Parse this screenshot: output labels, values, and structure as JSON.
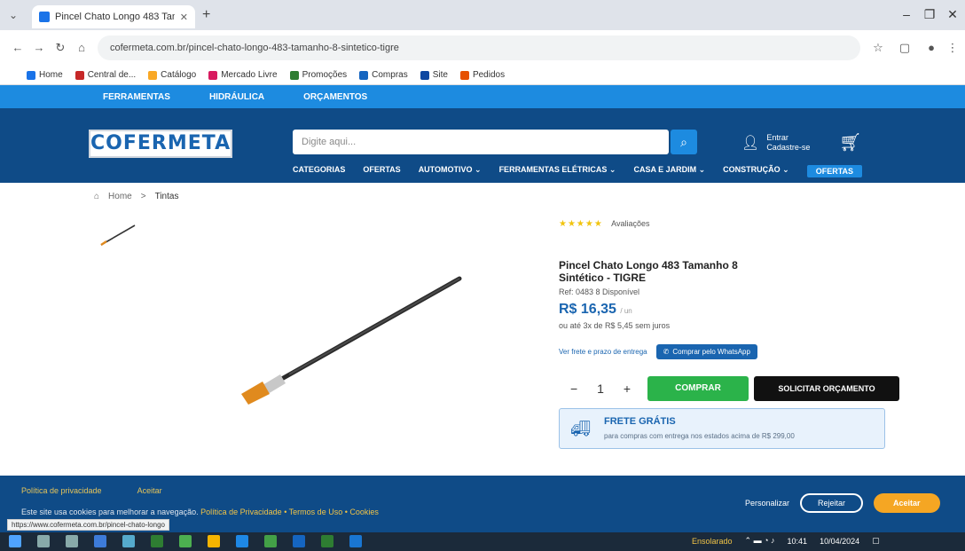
{
  "browser": {
    "tab_title": "Pincel Chato Longo 483 Tama",
    "url": "cofermeta.com.br/pincel-chato-longo-483-tamanho-8-sintetico-tigre",
    "bookmarks": [
      "Home",
      "Central de...",
      "Catálogo",
      "Mercado Livre",
      "Promoções",
      "Compras",
      "Site",
      "Pedidos"
    ]
  },
  "top_strip": [
    "FERRAMENTAS",
    "HIDRÁULICA",
    "ORÇAMENTOS"
  ],
  "header": {
    "logo": "COFERMETA",
    "search_placeholder": "Digite aqui...",
    "account_line1": "Entrar",
    "account_line2": "Cadastre-se",
    "menu": [
      "CATEGORIAS",
      "OFERTAS",
      "AUTOMOTIVO ⌄",
      "FERRAMENTAS ELÉTRICAS ⌄",
      "CASA E JARDIM ⌄",
      "CONSTRUÇÃO ⌄",
      "OFERTAS"
    ]
  },
  "breadcrumb": {
    "home": "Home",
    "sep": ">",
    "current": "Tintas"
  },
  "product": {
    "rating_stars": "★★★★★",
    "reviews": "Avaliações",
    "name": "Pincel Chato Longo 483 Tamanho 8 Sintético - TIGRE",
    "sku": "Ref: 0483 8 Disponível",
    "price": "R$ 16,35",
    "price_unit": "/ un",
    "installments": "ou até 3x de R$ 5,45 sem juros",
    "shipping_link": "Ver frete e prazo de entrega",
    "whatsapp_label": "Comprar pelo WhatsApp",
    "quantity": "1",
    "buy_label": "COMPRAR",
    "quote_label": "SOLICITAR ORÇAMENTO",
    "frete_title": "FRETE GRÁTIS",
    "frete_sub": "para compras com entrega nos estados acima de R$ 299,00"
  },
  "cookie": {
    "title": "Política de privacidade",
    "link": "Aceitar",
    "text": "Este site usa cookies para melhorar a navegação.",
    "links": "Política de Privacidade  •  Termos de Uso  •  Cookies",
    "manage": "Personalizar",
    "reject": "Rejeitar",
    "accept": "Aceitar"
  },
  "status_url": "https://www.cofermeta.com.br/pincel-chato-longo",
  "taskbar": {
    "weather": "Ensolarado",
    "time": "10:41",
    "date": "10/04/2024"
  },
  "colors": {
    "brand_dark": "#0f4b87",
    "brand_light": "#1d8be0",
    "buy": "#2bb34a"
  }
}
